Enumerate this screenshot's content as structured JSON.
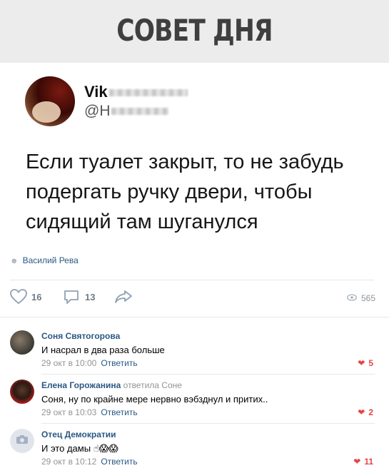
{
  "header": {
    "title": "СОВЕТ ДНЯ"
  },
  "tweet": {
    "name_visible": "Vik",
    "handle_visible": "@H",
    "text": "Если туалет закрыт, то не забудь подергать ручку двери, чтобы сидящий там шуганулся"
  },
  "post": {
    "author": "Василий Рева",
    "likes": "16",
    "comments": "13",
    "views": "565"
  },
  "comments": [
    {
      "name": "Соня Святогорова",
      "reply_to": "",
      "text": "И насрал в два раза больше",
      "time": "29 окт в 10:00",
      "reply_label": "Ответить",
      "likes": "5"
    },
    {
      "name": "Елена Горожанина",
      "reply_to": "ответила Соне",
      "text": "Соня, ну по крайне мере нервно вэбзднул и притих..",
      "time": "29 окт в 10:03",
      "reply_label": "Ответить",
      "likes": "2"
    },
    {
      "name": "Отец Демократии",
      "reply_to": "",
      "text": "И это дамы",
      "emoji": "☝😱😱",
      "time": "29 окт в 10:12",
      "reply_label": "Ответить",
      "likes": "11"
    }
  ],
  "colors": {
    "link": "#2a5885",
    "meta": "#939393",
    "like_red": "#e64646",
    "title_gray": "#3f3f3f"
  },
  "icons": [
    "user-icon",
    "heart-icon",
    "comment-icon",
    "share-icon",
    "eye-icon",
    "camera-icon"
  ]
}
